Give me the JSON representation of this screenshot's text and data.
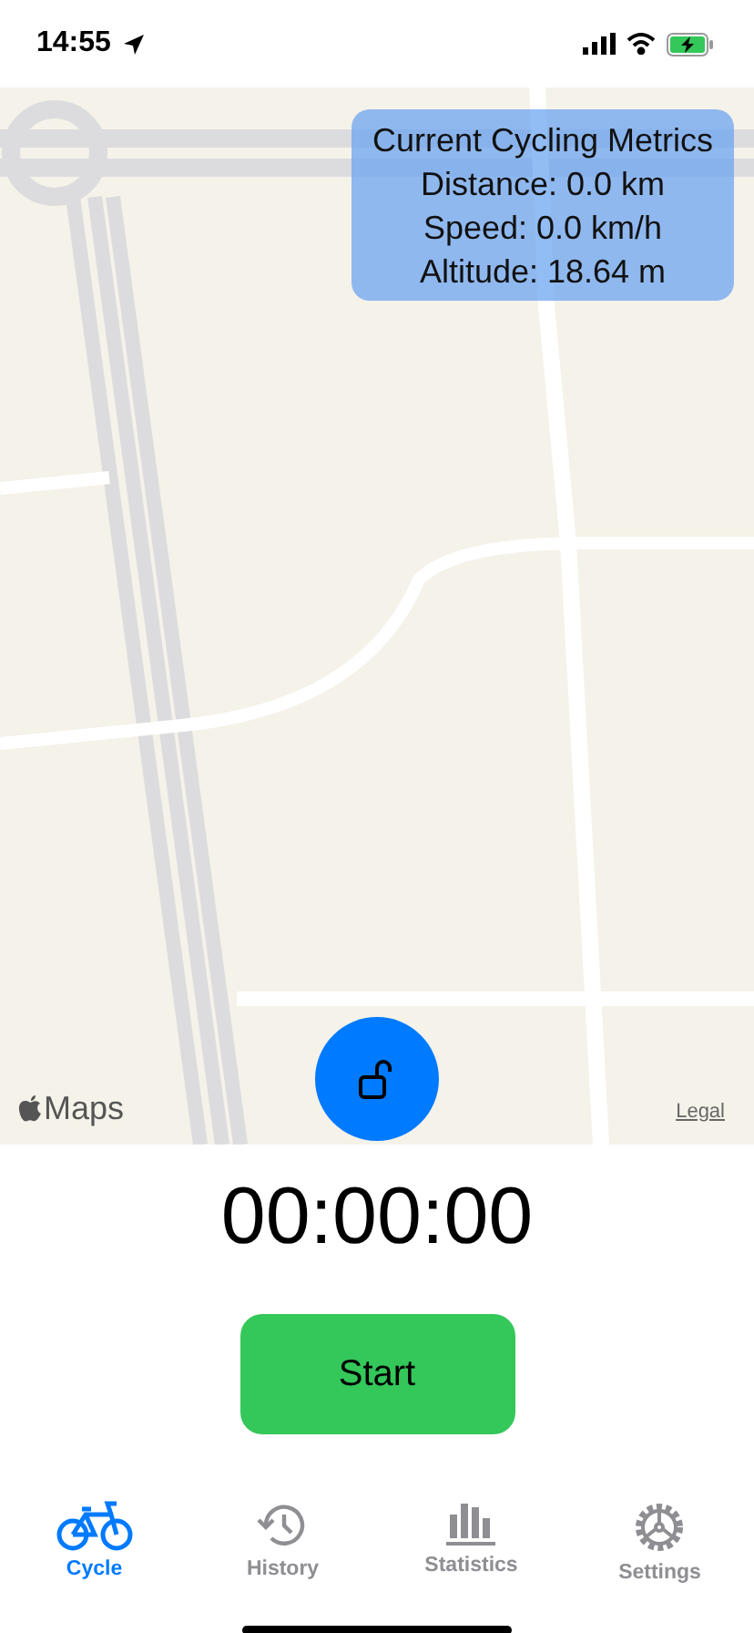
{
  "status_bar": {
    "time": "14:55"
  },
  "map": {
    "logo": "Maps",
    "legal": "Legal"
  },
  "metrics": {
    "title": "Current Cycling Metrics",
    "lines": [
      "Distance: 0.0 km",
      "Speed: 0.0 km/h",
      "Altitude: 18.64 m"
    ]
  },
  "lock_button": {
    "locked": false
  },
  "timer": "00:00:00",
  "start_button": "Start",
  "tabs": [
    {
      "kind": "bicycle",
      "label": "Cycle",
      "selected": true
    },
    {
      "kind": "history",
      "label": "History",
      "selected": false
    },
    {
      "kind": "chart",
      "label": "Statistics",
      "selected": false
    },
    {
      "kind": "gear",
      "label": "Settings",
      "selected": false
    }
  ]
}
